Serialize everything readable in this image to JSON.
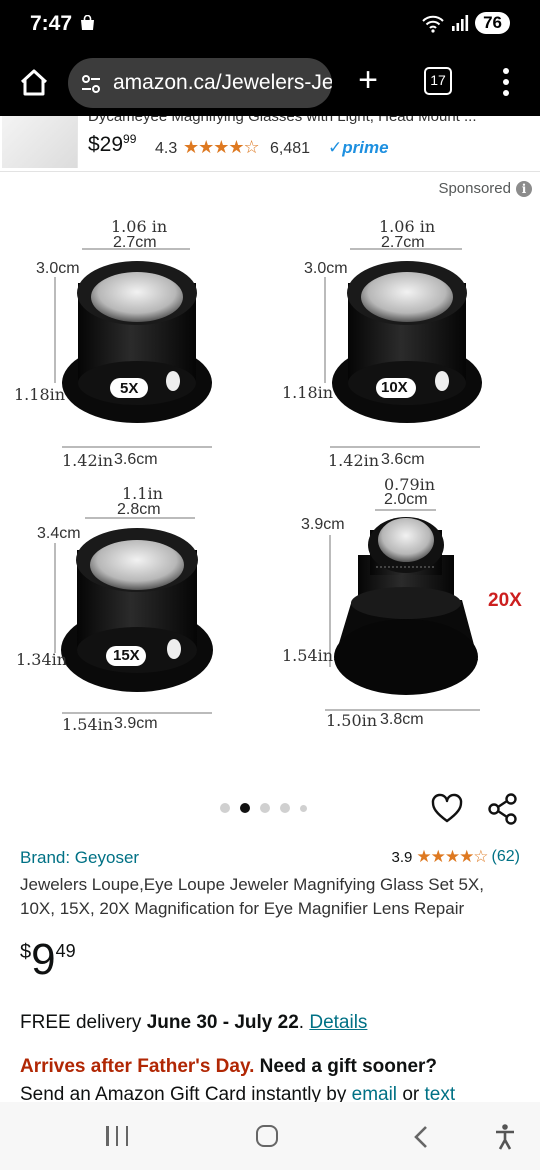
{
  "status_bar": {
    "time": "7:47",
    "battery": "76"
  },
  "browser": {
    "url": "amazon.ca/Jewelers-Je",
    "tab_count": "17"
  },
  "sticky_product": {
    "title": "Dycameyee Magnifying Glasses with Light, Head Mount ...",
    "price_whole": "$29",
    "price_frac": "99",
    "rating": "4.3",
    "stars": "★★★★☆",
    "review_count": "6,481",
    "prime": "✓prime"
  },
  "sponsored_label": "Sponsored",
  "product_image": {
    "loupe_5x": {
      "top_dim_in": "1.06 in",
      "top_dim_cm": "2.7cm",
      "side_cm": "3.0cm",
      "height_in": "1.18in",
      "badge": "5X",
      "bottom_in": "1.42in",
      "bottom_cm": "3.6cm"
    },
    "loupe_10x": {
      "top_dim_in": "1.06 in",
      "top_dim_cm": "2.7cm",
      "side_cm": "3.0cm",
      "height_in": "1.18in",
      "badge": "10X",
      "bottom_in": "1.42in",
      "bottom_cm": "3.6cm"
    },
    "loupe_15x": {
      "top_dim_in": "1.1in",
      "top_dim_cm": "2.8cm",
      "side_cm": "3.4cm",
      "height_in": "1.34in",
      "badge": "15X",
      "bottom_in": "1.54in",
      "bottom_cm": "3.9cm"
    },
    "loupe_20x": {
      "top_dim_in": "0.79in",
      "top_dim_cm": "2.0cm",
      "side_cm": "3.9cm",
      "height_in": "1.54in",
      "label": "20X",
      "bottom_in": "1.50in",
      "bottom_cm": "3.8cm"
    }
  },
  "carousel": {
    "image_count": 5,
    "active_index": 1
  },
  "product": {
    "brand": "Brand: Geyoser",
    "rating": "3.9",
    "stars": "★★★★☆",
    "review_count": "(62)",
    "title": "Jewelers Loupe,Eye Loupe Jeweler Magnifying Glass Set 5X, 10X, 15X, 20X Magnification for Eye Magnifier Lens Repair",
    "price_symbol": "$",
    "price_whole": "9",
    "price_fraction": "49"
  },
  "delivery": {
    "prefix": "FREE delivery",
    "dates": "June 30 - July 22",
    "link": "Details"
  },
  "gift": {
    "warning": "Arrives after Father's Day.",
    "question": "Need a gift sooner?",
    "line2_prefix": "Send an Amazon Gift Card instantly by",
    "email_link": "email",
    "or": "or",
    "text_link": "text"
  },
  "colors": {
    "link": "#007185",
    "star": "#de7921",
    "alert_red": "#b12704",
    "prime_blue": "#1e90e0"
  }
}
